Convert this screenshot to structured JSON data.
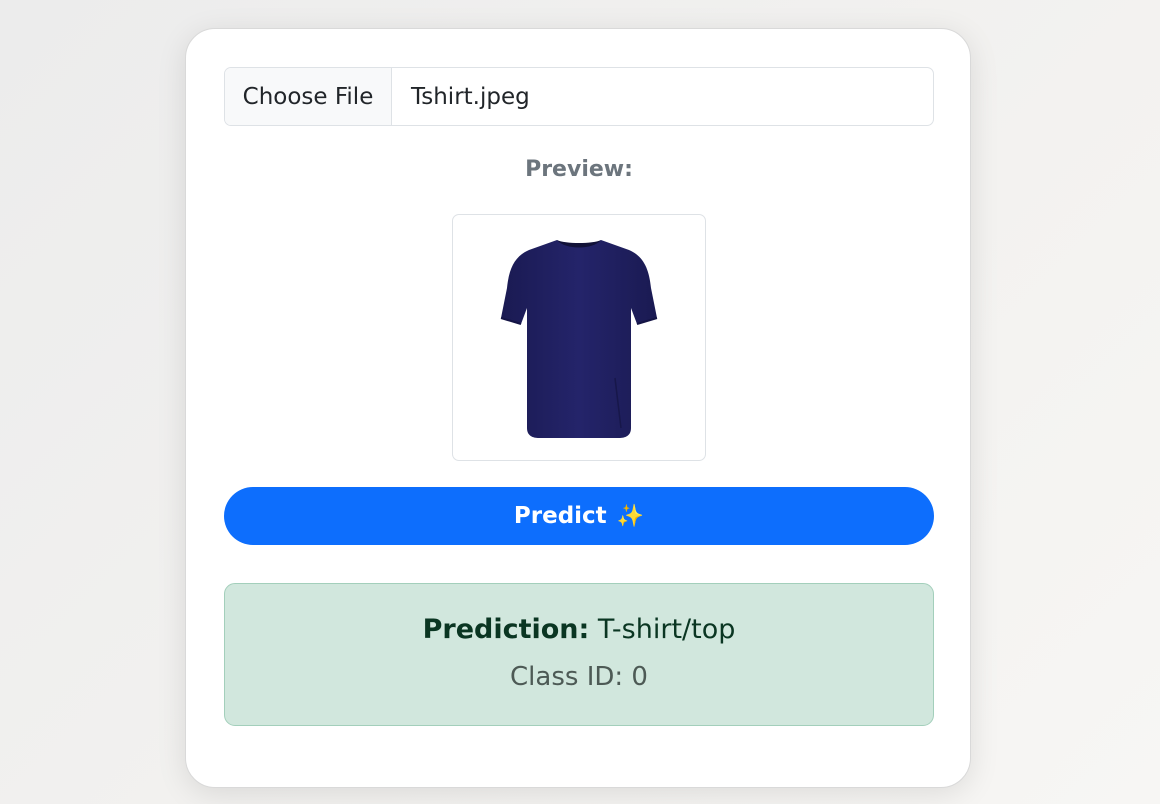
{
  "upload": {
    "button_label": "Choose File",
    "file_name": "Tshirt.jpeg"
  },
  "preview": {
    "label": "Preview:",
    "image_alt": "navy t-shirt",
    "shirt_color": "#1f1f5e"
  },
  "predict_button": {
    "label": "Predict",
    "icon": "sparkles-icon",
    "emoji": "✨",
    "color": "#0d6efd"
  },
  "result": {
    "prediction_label": "Prediction:",
    "prediction_value": "T-shirt/top",
    "class_id_text": "Class ID: 0",
    "background_color": "#d1e7dd"
  }
}
